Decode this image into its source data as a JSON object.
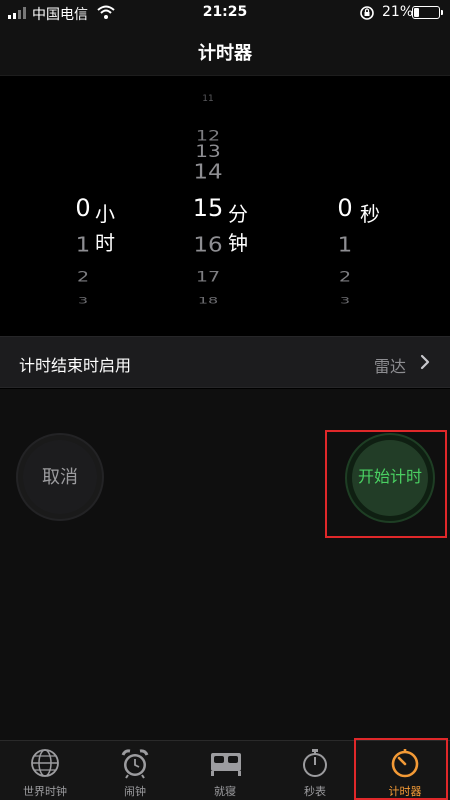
{
  "status_bar": {
    "carrier": "中国电信",
    "time": "21:25",
    "battery_percent": "21%",
    "battery_level": 0.21,
    "icons": [
      "signal-icon",
      "wifi-icon",
      "orientation-lock-icon",
      "battery-icon"
    ]
  },
  "nav": {
    "title": "计时器"
  },
  "picker": {
    "hours": {
      "selected": "0",
      "unit": "小时",
      "below": [
        "1",
        "2",
        "3"
      ]
    },
    "minutes": {
      "above_far": "11",
      "above": [
        "12",
        "13",
        "14"
      ],
      "selected": "15",
      "unit": "分钟",
      "below": [
        "16",
        "17",
        "18"
      ]
    },
    "seconds": {
      "selected": "0",
      "unit": "秒",
      "below": [
        "1",
        "2",
        "3"
      ]
    }
  },
  "sound_row": {
    "label": "计时结束时启用",
    "value": "雷达"
  },
  "buttons": {
    "cancel": "取消",
    "start": "开始计时"
  },
  "tabs": [
    {
      "label": "世界时钟",
      "icon": "globe-icon"
    },
    {
      "label": "闹钟",
      "icon": "alarm-clock-icon"
    },
    {
      "label": "就寝",
      "icon": "bed-icon"
    },
    {
      "label": "秒表",
      "icon": "stopwatch-icon"
    },
    {
      "label": "计时器",
      "icon": "timer-icon",
      "active": true
    }
  ],
  "colors": {
    "accent_orange": "#f39a36",
    "start_green": "#4ad062",
    "highlight_red": "#e0282a"
  }
}
